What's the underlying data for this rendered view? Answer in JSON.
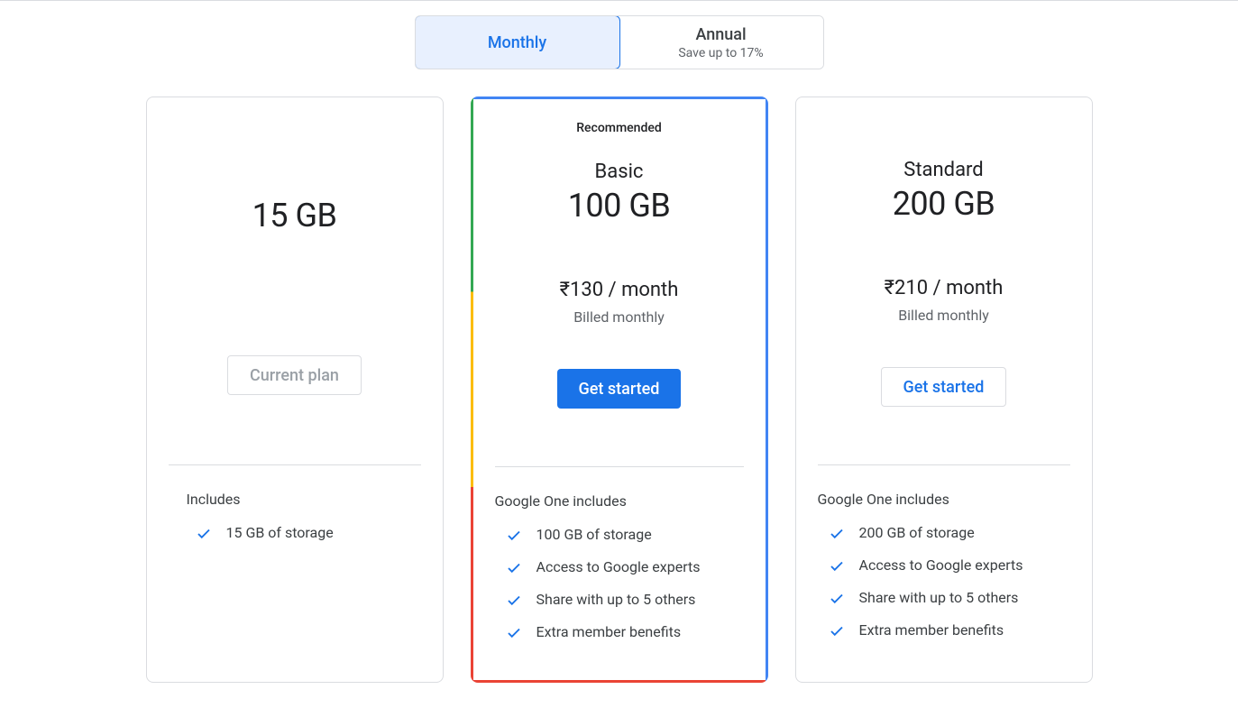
{
  "toggle": {
    "monthly": "Monthly",
    "annual": "Annual",
    "annual_sub": "Save up to 17%"
  },
  "plans": {
    "free": {
      "size": "15 GB",
      "cta": "Current plan",
      "includes_title": "Includes",
      "features": [
        "15 GB of storage"
      ]
    },
    "basic": {
      "badge": "Recommended",
      "name": "Basic",
      "size": "100 GB",
      "price": "₹130 / month",
      "billing": "Billed monthly",
      "cta": "Get started",
      "includes_title": "Google One includes",
      "features": [
        "100 GB of storage",
        "Access to Google experts",
        "Share with up to 5 others",
        "Extra member benefits"
      ]
    },
    "standard": {
      "name": "Standard",
      "size": "200 GB",
      "price": "₹210 / month",
      "billing": "Billed monthly",
      "cta": "Get started",
      "includes_title": "Google One includes",
      "features": [
        "200 GB of storage",
        "Access to Google experts",
        "Share with up to 5 others",
        "Extra member benefits"
      ]
    }
  }
}
